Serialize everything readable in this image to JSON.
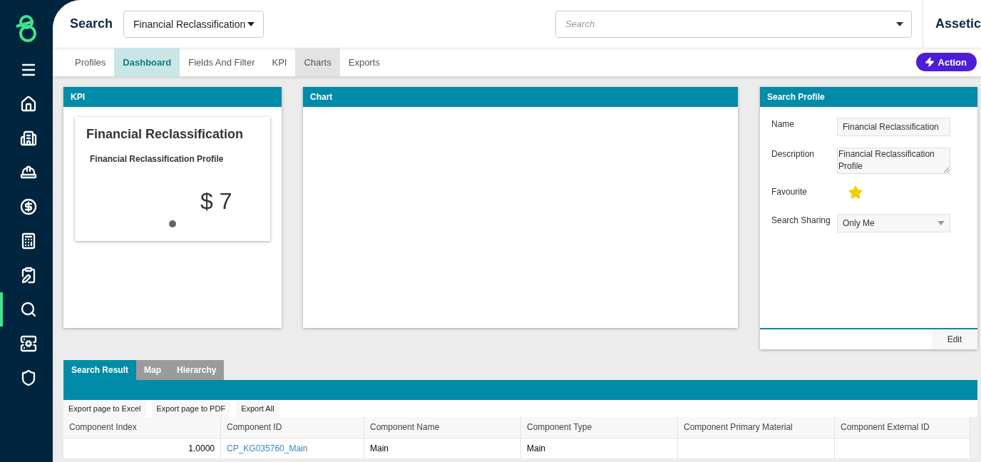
{
  "sidebar": {
    "items": [
      {
        "kind": "menu",
        "selected": false
      },
      {
        "kind": "home",
        "selected": false
      },
      {
        "kind": "building",
        "selected": false
      },
      {
        "kind": "worker",
        "selected": false
      },
      {
        "kind": "finance",
        "selected": false
      },
      {
        "kind": "calculator",
        "selected": false
      },
      {
        "kind": "edit",
        "selected": false
      },
      {
        "kind": "search",
        "selected": true
      },
      {
        "kind": "server",
        "selected": false
      },
      {
        "kind": "shield",
        "selected": false
      }
    ]
  },
  "header": {
    "title": "Search",
    "profile_select": "Financial Reclassification",
    "search": {
      "placeholder": "Search"
    },
    "org": "Assetic"
  },
  "tabs": [
    {
      "label": "Profiles",
      "selected": false,
      "hover": false
    },
    {
      "label": "Dashboard",
      "selected": true,
      "hover": false
    },
    {
      "label": "Fields And Filter",
      "selected": false,
      "hover": false
    },
    {
      "label": "KPI",
      "selected": false,
      "hover": false
    },
    {
      "label": "Charts",
      "selected": false,
      "hover": true
    },
    {
      "label": "Exports",
      "selected": false,
      "hover": false
    }
  ],
  "action_button": "Action",
  "kpi_panel": {
    "title": "KPI",
    "card": {
      "title": "Financial Reclassification",
      "subtitle": "Financial Reclassification Profile",
      "value": "$ 7"
    }
  },
  "chart_panel": {
    "title": "Chart"
  },
  "profile_panel": {
    "title": "Search Profile",
    "name_label": "Name",
    "name": "Financial Reclassification",
    "description_label": "Description",
    "description": "Financial Reclassification Profile",
    "favourite_label": "Favourite",
    "favourite": true,
    "sharing_label": "Search Sharing",
    "sharing": "Only Me",
    "edit_button": "Edit"
  },
  "results": {
    "tabs": [
      {
        "label": "Search Result",
        "selected": true
      },
      {
        "label": "Map",
        "selected": false
      },
      {
        "label": "Hierarchy",
        "selected": false
      }
    ],
    "export_buttons": [
      "Export page to Excel",
      "Export page to PDF",
      "Export All"
    ],
    "columns": [
      "Component Index",
      "Component ID",
      "Component Name",
      "Component Type",
      "Component Primary Material",
      "Component External ID"
    ],
    "rows": [
      {
        "cells": [
          {
            "kind": "number",
            "text": "1.0000"
          },
          {
            "kind": "link",
            "text": "CP_KG035760_Main"
          },
          {
            "kind": "text",
            "text": "Main"
          },
          {
            "kind": "text",
            "text": "Main"
          }
        ]
      }
    ]
  }
}
